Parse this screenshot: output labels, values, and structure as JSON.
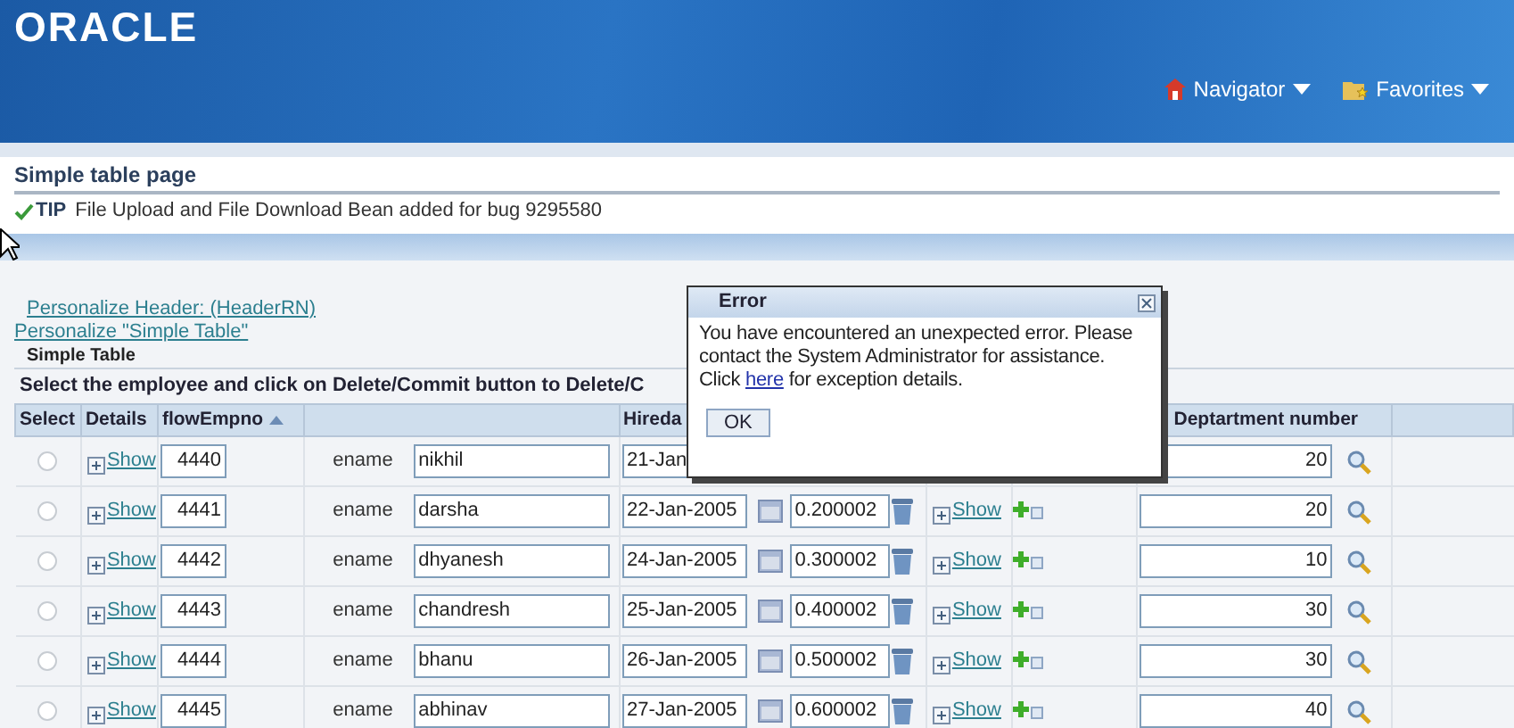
{
  "header": {
    "logo": "ORACLE",
    "menus": [
      {
        "label": "Navigator"
      },
      {
        "label": "Favorites"
      }
    ]
  },
  "page_title": "Simple table page",
  "tip": {
    "label": "TIP",
    "text": "File Upload and File Download Bean added for bug 9295580"
  },
  "personalize_links": [
    "Personalize Header: (HeaderRN)",
    "Personalize \"Simple Table\""
  ],
  "table": {
    "title": "Simple Table",
    "instruction": "Select the employee and click on Delete/Commit button to Delete/C",
    "columns": [
      {
        "label": "Select"
      },
      {
        "label": "Details"
      },
      {
        "label": "flowEmpno",
        "sorted": true
      },
      {
        "label": "Hireda"
      },
      {
        "label": "Deptartment number"
      }
    ],
    "rows": [
      {
        "selected": false,
        "empno": "4440",
        "details": "Show",
        "ename_label": "ename",
        "ename": "nikhil",
        "hiredate": "21-Jan",
        "dept": "20"
      },
      {
        "selected": false,
        "empno": "4441",
        "details": "Show",
        "ename_label": "ename",
        "ename": "darsha",
        "hiredate": "22-Jan-2005",
        "rate": "0.200002",
        "details2": "Show",
        "dept": "20"
      },
      {
        "selected": false,
        "empno": "4442",
        "details": "Show",
        "ename_label": "ename",
        "ename": "dhyanesh",
        "hiredate": "24-Jan-2005",
        "rate": "0.300002",
        "details2": "Show",
        "dept": "10"
      },
      {
        "selected": false,
        "empno": "4443",
        "details": "Show",
        "ename_label": "ename",
        "ename": "chandresh",
        "hiredate": "25-Jan-2005",
        "rate": "0.400002",
        "details2": "Show",
        "dept": "30"
      },
      {
        "selected": false,
        "empno": "4444",
        "details": "Show",
        "ename_label": "ename",
        "ename": "bhanu",
        "hiredate": "26-Jan-2005",
        "rate": "0.500002",
        "details2": "Show",
        "dept": "30"
      },
      {
        "selected": false,
        "empno": "4445",
        "details": "Show",
        "ename_label": "ename",
        "ename": "abhinav",
        "hiredate": "27-Jan-2005",
        "rate": "0.600002",
        "details2": "Show",
        "dept": "40"
      }
    ]
  },
  "dialog": {
    "title": "Error",
    "message_before": "You have encountered an unexpected error. Please contact the System Administrator for assistance. Click ",
    "link": "here",
    "message_after": " for exception details.",
    "button": "OK"
  }
}
